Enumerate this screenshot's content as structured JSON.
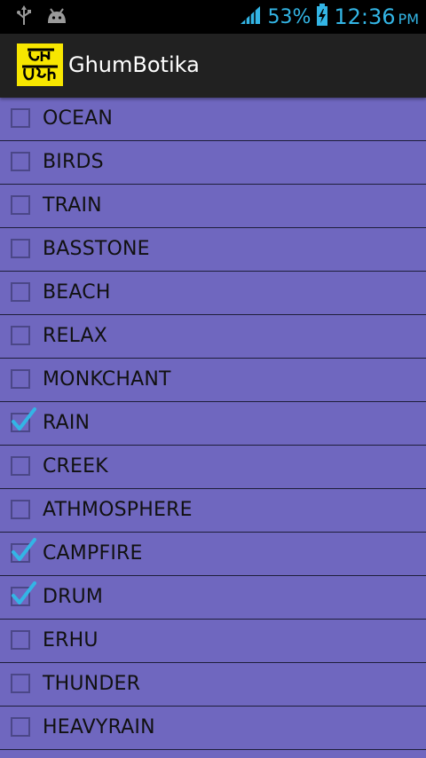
{
  "status_bar": {
    "battery_percent": "53%",
    "time": "12:36",
    "ampm": "PM",
    "icons": [
      "usb-icon",
      "android-debug-icon",
      "signal-icon",
      "battery-charging-icon"
    ],
    "accent_color": "#33b5e5"
  },
  "action_bar": {
    "title": "GhumBotika",
    "logo_text": "ঘুম বটিকা"
  },
  "sounds": [
    {
      "label": "OCEAN",
      "checked": false
    },
    {
      "label": "BIRDS",
      "checked": false
    },
    {
      "label": "TRAIN",
      "checked": false
    },
    {
      "label": "BASSTONE",
      "checked": false
    },
    {
      "label": "BEACH",
      "checked": false
    },
    {
      "label": "RELAX",
      "checked": false
    },
    {
      "label": "MONKCHANT",
      "checked": false
    },
    {
      "label": "RAIN",
      "checked": true
    },
    {
      "label": "CREEK",
      "checked": false
    },
    {
      "label": "ATHMOSPHERE",
      "checked": false
    },
    {
      "label": "CAMPFIRE",
      "checked": true
    },
    {
      "label": "DRUM",
      "checked": true
    },
    {
      "label": "ERHU",
      "checked": false
    },
    {
      "label": "THUNDER",
      "checked": false
    },
    {
      "label": "HEAVYRAIN",
      "checked": false
    }
  ],
  "colors": {
    "background": "#6f67bf",
    "action_bar": "#212121",
    "logo_background": "#f7e600",
    "check_mark": "#33b5e5"
  }
}
